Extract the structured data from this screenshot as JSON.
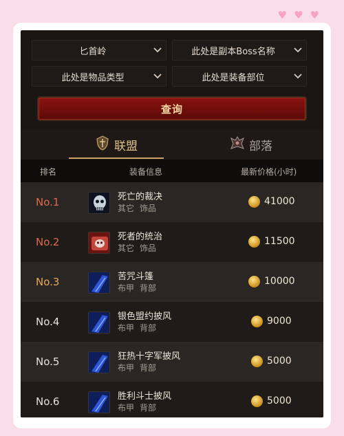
{
  "filters": {
    "dungeon": "匕首岭",
    "boss": "此处是副本Boss名称",
    "item_type": "此处是物品类型",
    "slot": "此处是装备部位"
  },
  "query_label": "查询",
  "tabs": [
    {
      "label": "联盟",
      "icon": "alliance-crest-icon",
      "active": true
    },
    {
      "label": "部落",
      "icon": "horde-crest-icon",
      "active": false
    }
  ],
  "table_headers": {
    "rank": "排名",
    "item": "装备信息",
    "price": "最新价格(小时)"
  },
  "rows": [
    {
      "rank": "No.1",
      "name": "死亡的裁决",
      "cat1": "其它",
      "cat2": "饰品",
      "price": "41000",
      "icon": "skull-trinket-icon"
    },
    {
      "rank": "No.2",
      "name": "死者的统治",
      "cat1": "其它",
      "cat2": "饰品",
      "price": "11500",
      "icon": "red-trinket-icon"
    },
    {
      "rank": "No.3",
      "name": "苦咒斗篷",
      "cat1": "布甲",
      "cat2": "背部",
      "price": "10000",
      "icon": "blue-cloak-icon"
    },
    {
      "rank": "No.4",
      "name": "银色盟约披风",
      "cat1": "布甲",
      "cat2": "背部",
      "price": "9000",
      "icon": "blue-cloak-icon"
    },
    {
      "rank": "No.5",
      "name": "狂热十字军披风",
      "cat1": "布甲",
      "cat2": "背部",
      "price": "5000",
      "icon": "blue-cloak-icon"
    },
    {
      "rank": "No.6",
      "name": "胜利斗士披风",
      "cat1": "布甲",
      "cat2": "背部",
      "price": "5000",
      "icon": "blue-cloak-icon"
    }
  ],
  "colors": {
    "rank_top": "#e06a4a",
    "rank_mid": "#e8a85a",
    "rank_rest": "#e6e1d8",
    "accent_gold": "#e0c18a"
  }
}
